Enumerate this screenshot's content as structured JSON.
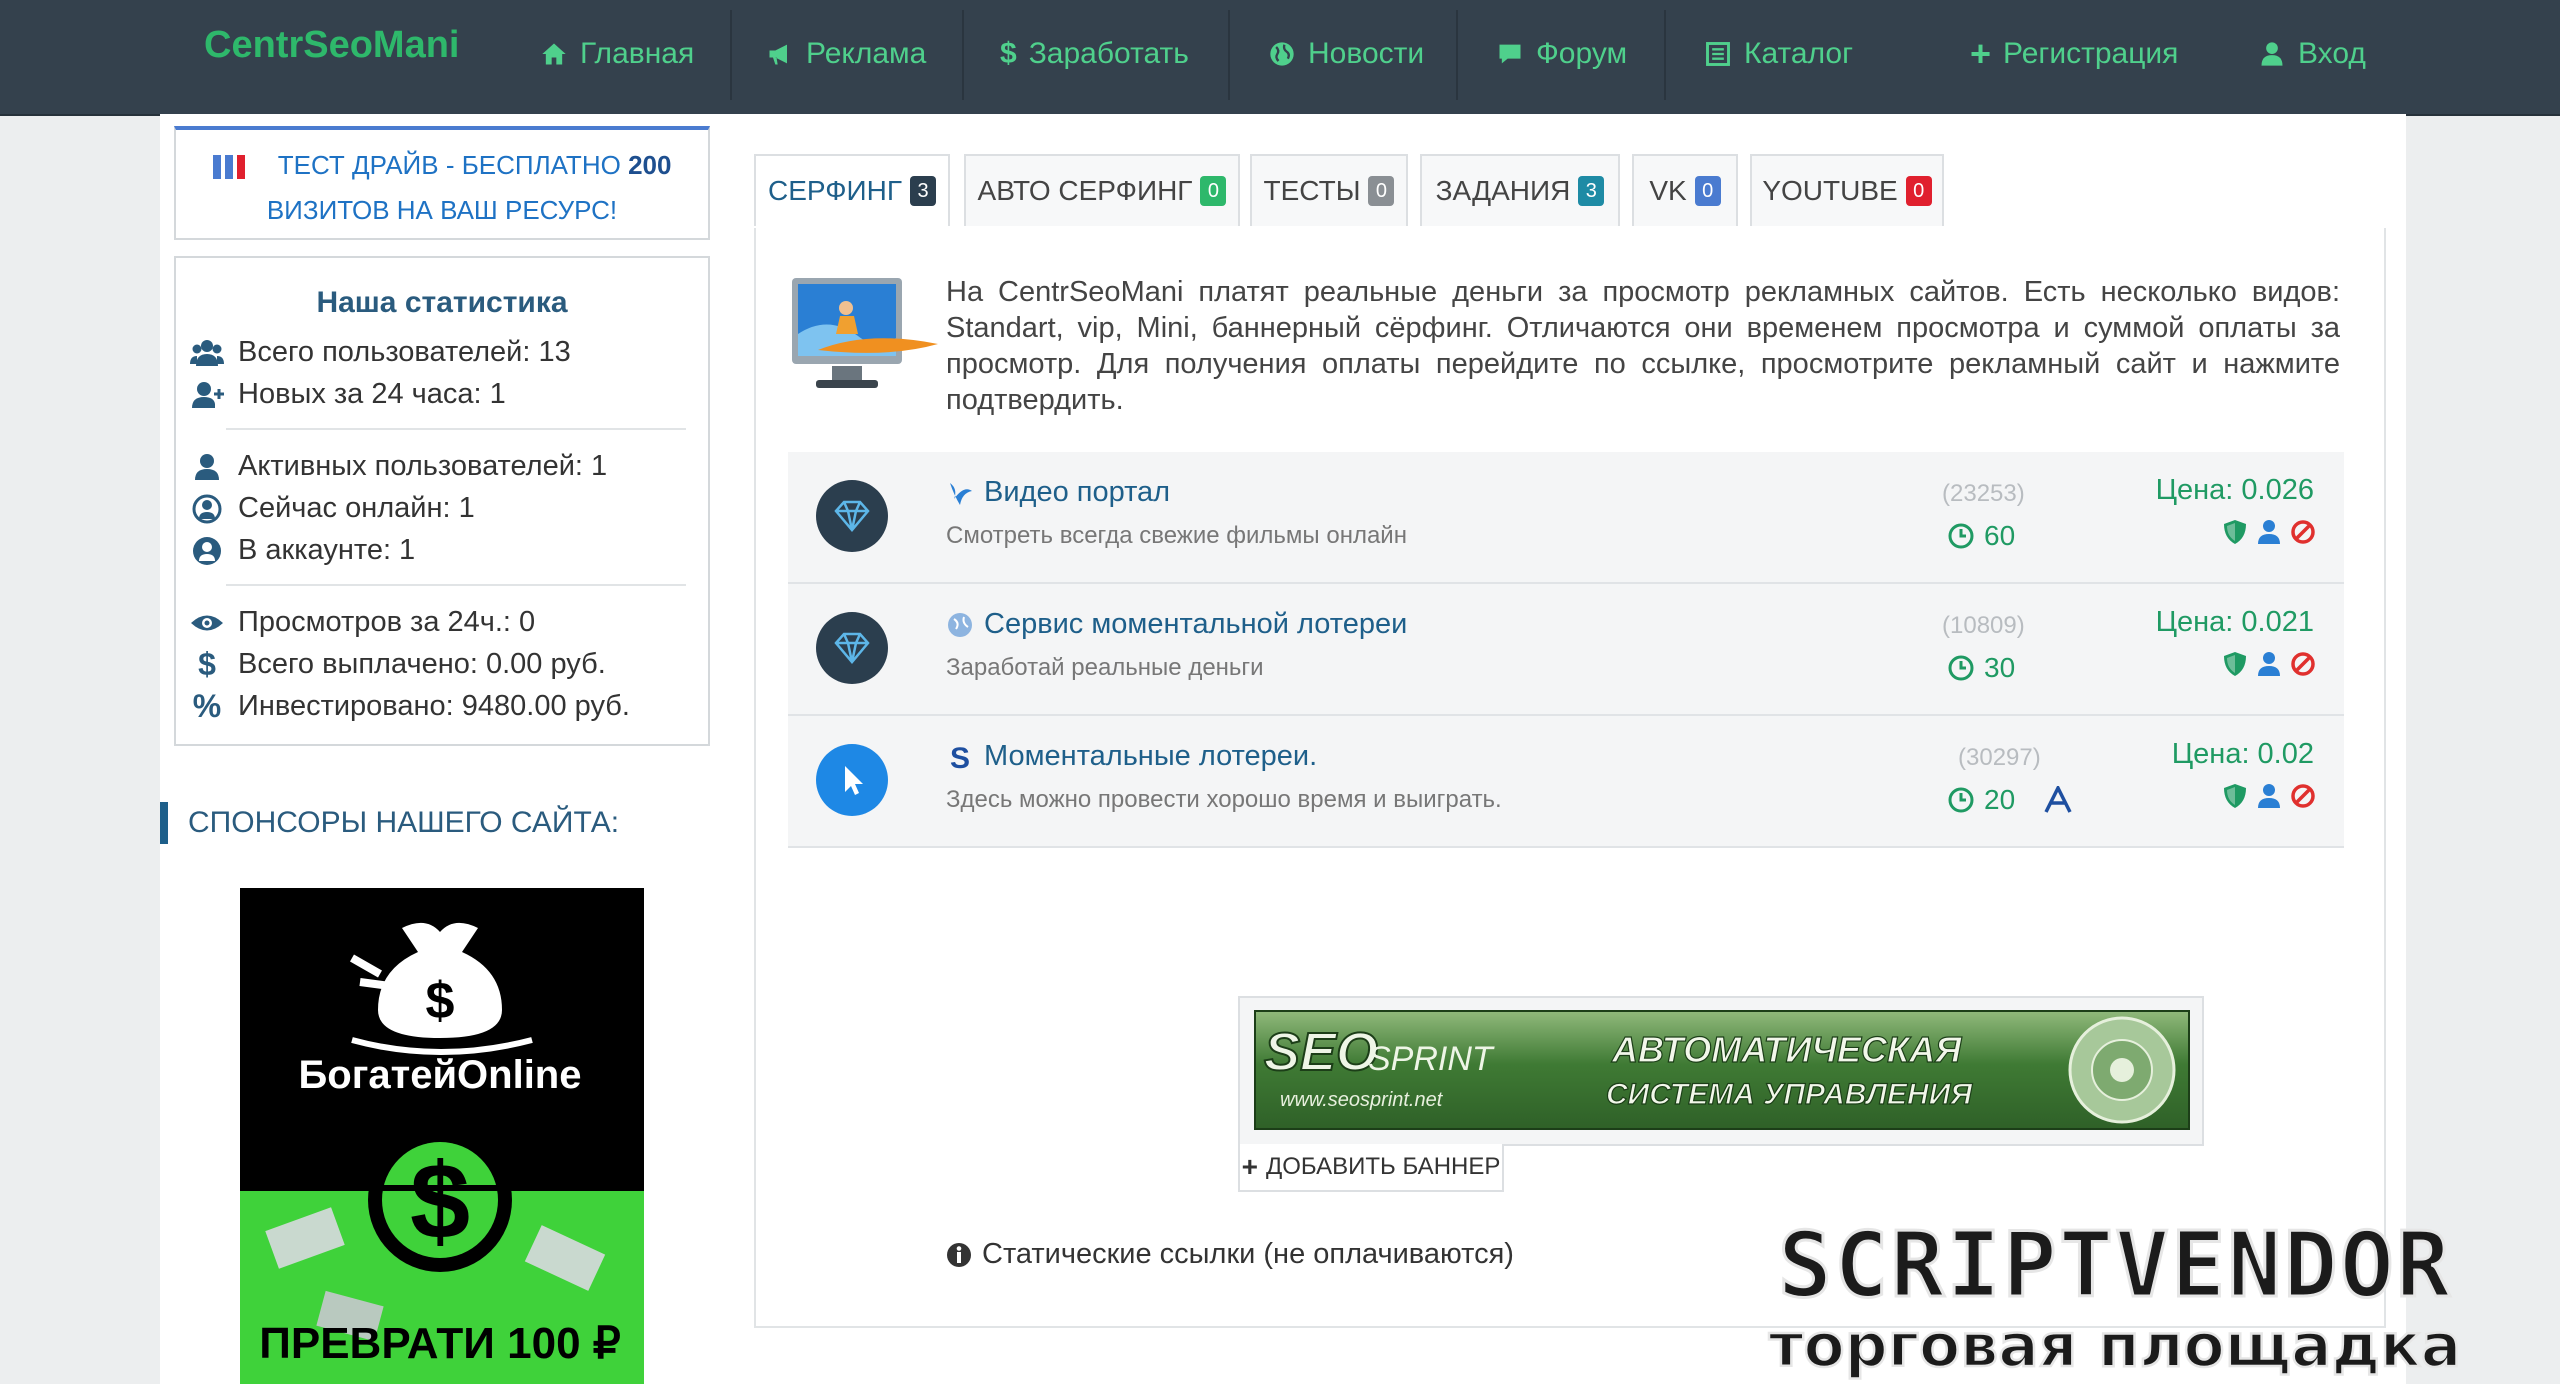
{
  "nav": {
    "brand": "CentrSeoMani",
    "items": [
      {
        "label": "Главная",
        "icon": "home-icon"
      },
      {
        "label": "Реклама",
        "icon": "bullhorn-icon"
      },
      {
        "label": "Заработать",
        "icon": "dollar-icon"
      },
      {
        "label": "Новости",
        "icon": "globe-icon"
      },
      {
        "label": "Форум",
        "icon": "comment-icon"
      },
      {
        "label": "Каталог",
        "icon": "list-icon"
      },
      {
        "label": "Регистрация",
        "icon": "plus-icon"
      },
      {
        "label": "Вход",
        "icon": "user-icon"
      }
    ]
  },
  "sidebar": {
    "testdrive": {
      "prefix": "ТЕСТ ДРАЙВ - БЕСПЛАТНО",
      "number": "200",
      "line2": "ВИЗИТОВ НА ВАШ РЕСУРС!"
    },
    "stats": {
      "title": "Наша статистика",
      "rows": [
        "Всего пользователей: 13",
        "Новых за 24 часа: 1",
        "Активных пользователей: 1",
        "Сейчас онлайн: 1",
        "В аккаунте: 1",
        "Просмотров за 24ч.: 0",
        "Всего выплачено: 0.00 руб.",
        "Инвестировано: 9480.00 руб."
      ]
    },
    "sponsors_title": "СПОНСОРЫ НАШЕГО САЙТА:",
    "sponsor_banner": {
      "brand": "БогатейOnline",
      "slogan": "ПРЕВРАТИ 100 ₽"
    }
  },
  "tabs": [
    {
      "label": "СЕРФИНГ",
      "count": "3",
      "color": "#2b3e4e"
    },
    {
      "label": "АВТО СЕРФИНГ",
      "count": "0",
      "color": "#2eb86b"
    },
    {
      "label": "ТЕСТЫ",
      "count": "0",
      "color": "#8a8f94"
    },
    {
      "label": "ЗАДАНИЯ",
      "count": "3",
      "color": "#1e8ba5"
    },
    {
      "label": "VK",
      "count": "0",
      "color": "#4a7bd0"
    },
    {
      "label": "YOUTUBE",
      "count": "0",
      "color": "#e0202e"
    }
  ],
  "intro": "На CentrSeoMani платят реальные деньги за просмотр рекламных сайтов. Есть несколько видов: Standart, vip, Mini, баннерный сёрфинг. Отличаются они временем просмотра и суммой оплаты за просмотр. Для получения оплаты перейдите по ссылке, просмотрите рекламный сайт и нажмите подтвердить.",
  "sites": [
    {
      "title": "Видео портал",
      "desc": "Смотреть всегда свежие фильмы онлайн",
      "count": "(23253)",
      "seconds": "60",
      "price": "Цена: 0.026"
    },
    {
      "title": "Сервис моментальной лотереи",
      "desc": "Заработай реальные деньги",
      "count": "(10809)",
      "seconds": "30",
      "price": "Цена: 0.021"
    },
    {
      "title": "Моментальные лотереи.",
      "desc": "Здесь можно провести хорошо время и выиграть.",
      "count": "(30297)",
      "seconds": "20",
      "price": "Цена: 0.02"
    }
  ],
  "banner": {
    "logo_main": "SEO",
    "logo_sub": "SPRINT",
    "url": "www.seosprint.net",
    "line1": "АВТОМАТИЧЕСКАЯ",
    "line2": "СИСТЕМА УПРАВЛЕНИЯ"
  },
  "add_banner": "ДОБАВИТЬ БАННЕР",
  "static_links": "Статические ссылки (не оплачиваются)",
  "watermark": {
    "line1": "SCRIPTVENDOR",
    "line2": "торговая площадка"
  }
}
